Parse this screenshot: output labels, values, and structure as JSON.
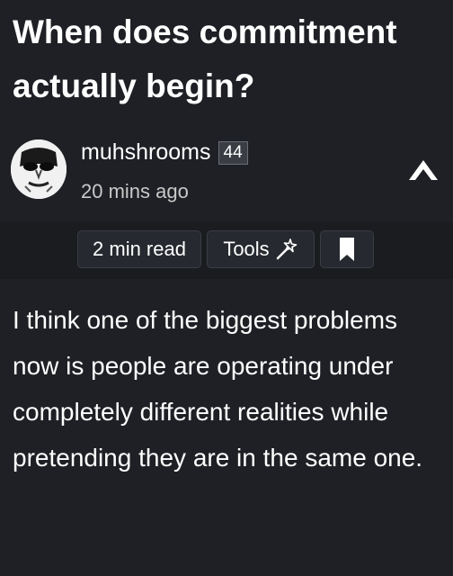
{
  "post": {
    "title": "When does commitment actually begin?",
    "author": "muhshrooms",
    "reputation": "44",
    "timestamp": "20 mins ago",
    "body": "I think one of the biggest problems now is people are operating under completely different realities while pretending they are in the same one."
  },
  "toolbar": {
    "read_time": "2 min read",
    "tools_label": "Tools"
  },
  "icons": {
    "collapse": "chevron-up-icon",
    "tools": "magic-wand-icon",
    "bookmark": "bookmark-icon"
  },
  "colors": {
    "background": "#1e2025",
    "toolbar_strip": "#1a1c20",
    "pill_background": "#26292f",
    "secondary_text": "#c9c9c9"
  }
}
